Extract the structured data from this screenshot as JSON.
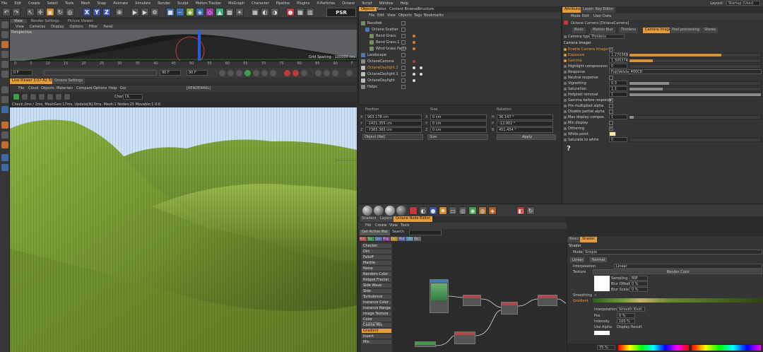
{
  "menubar": [
    "File",
    "Edit",
    "Create",
    "Select",
    "Tools",
    "Mesh",
    "Snap",
    "Animate",
    "Simulate",
    "Render",
    "Sculpt",
    "Motion Tracker",
    "MoGraph",
    "Character",
    "Pipeline",
    "Plugins",
    "X-Particles",
    "Octane",
    "Script",
    "Window",
    "Help"
  ],
  "layout": {
    "label": "Layout:",
    "value": "Startup (User)"
  },
  "toolbar": {
    "x": "X",
    "y": "Y",
    "z": "Z",
    "psr": "PSR"
  },
  "viewport": {
    "tabs": [
      "View",
      "Render Settings",
      "Picture Viewer"
    ],
    "menus": [
      "View",
      "Cameras",
      "Display",
      "Options",
      "Filter",
      "Panel"
    ],
    "label": "Perspective",
    "grid": "Grid Spacing : 100000 cm"
  },
  "timeline": {
    "ticks": [
      "0",
      "5",
      "10",
      "15",
      "20",
      "25",
      "30",
      "35",
      "40",
      "45",
      "50",
      "55",
      "60",
      "65",
      "70",
      "75",
      "80",
      "85",
      "90",
      "F"
    ],
    "start": "0 F",
    "end": "90 F",
    "current": "90 F"
  },
  "liveviewer": {
    "tabs": [
      "Live Viewer 3.07-R2 Studio",
      "Octane Settings"
    ],
    "menus": [
      "File",
      "Cloud",
      "Objects",
      "Materials",
      "Compare",
      "Options",
      "Help",
      "Gui"
    ],
    "channel_label": "Chan:",
    "channel_value": "DL",
    "rendering": "[RENDERING]",
    "status": "Check:2ms / 2ms, MeshGen:17ms, Update[N]:0ms, Mesh:1 Nodes:25 Movable:1 0:0"
  },
  "objmgr": {
    "tabs": [
      "Objects",
      "Takes",
      "Content Browser",
      "Structure"
    ],
    "menus": [
      "File",
      "Edit",
      "View",
      "Objects",
      "Tags",
      "Bookmarks"
    ],
    "rows": [
      "Bendtek",
      "Octane Scatter",
      "Bend Grass",
      "Bend Grass.1",
      "Wind Grass Patch",
      "Landscape",
      "OctaneCamera",
      "OctaneDaylight.2",
      "OctaneDaylight.1",
      "OctaneDaylight",
      "Helps"
    ]
  },
  "coords": {
    "headers": [
      "Position",
      "Size",
      "Rotation"
    ],
    "rows": [
      {
        "axis": "X",
        "pos": "963.178 cm",
        "size": "0 cm",
        "rotL": "H",
        "rot": "36.147 °"
      },
      {
        "axis": "Y",
        "pos": "-1421.355 cm",
        "size": "0 cm",
        "rotL": "P",
        "rot": "-12.902 °"
      },
      {
        "axis": "Z",
        "pos": "-7365.365 cm",
        "size": "0 cm",
        "rotL": "B",
        "rot": "451.454 °"
      }
    ],
    "mode": "Object (Rel)",
    "sizemode": "Size",
    "apply": "Apply"
  },
  "attr": {
    "tabs": [
      "Attributes",
      "Layers",
      "Key Editor"
    ],
    "menus": [
      "Mode",
      "Edit",
      "User Data"
    ],
    "object": "Octane Camera [OctaneCamera]",
    "subtabs": [
      "Basic",
      "Motion Blur",
      "Thinlens",
      "Camera Imager",
      "Post processing",
      "Stereo"
    ],
    "camtype_label": "Camera type",
    "camtype": "Thinlens",
    "section": "Camera Imager",
    "params": [
      {
        "label": "Enable Camera Imager",
        "type": "check",
        "value": "✓",
        "orange": true
      },
      {
        "label": "Exposure",
        "type": "slider",
        "value": "1.270369",
        "fill": 0.7,
        "orange": true
      },
      {
        "label": "Gamma",
        "type": "slider",
        "value": "1.305374",
        "fill": 0.18,
        "orange": true
      },
      {
        "label": "Highlight compression",
        "type": "slider",
        "value": "0",
        "fill": 0.0
      },
      {
        "label": "Response",
        "type": "dropdown",
        "value": "Fuji|Velvia_400CD"
      },
      {
        "label": "Neutral response",
        "type": "check",
        "value": ""
      },
      {
        "label": "Vignetting",
        "type": "slider",
        "value": "0.3",
        "fill": 0.3
      },
      {
        "label": "Saturation",
        "type": "slider",
        "value": "1.1",
        "fill": 0.25
      },
      {
        "label": "Hotpixel removal",
        "type": "slider",
        "value": "1",
        "fill": 1.0
      },
      {
        "label": "Gamma before response",
        "type": "check",
        "value": "✓"
      },
      {
        "label": "Pre-multiplied alpha",
        "type": "check",
        "value": ""
      },
      {
        "label": "Disable partial alpha",
        "type": "check",
        "value": ""
      },
      {
        "label": "Max display compos.",
        "type": "slider",
        "value": "1",
        "fill": 0.03
      },
      {
        "label": "Min display",
        "type": "check",
        "value": ""
      },
      {
        "label": "Dithering",
        "type": "check",
        "value": "✓"
      },
      {
        "label": "White point",
        "type": "color",
        "value": ""
      },
      {
        "label": "Saturate to white",
        "type": "slider",
        "value": "0",
        "fill": 0.0
      }
    ],
    "help": "?"
  },
  "nodeeditor": {
    "tabs": [
      "Shaders",
      "Layers",
      "Octane Node Editor"
    ],
    "menus": [
      "File",
      "Create",
      "View",
      "Tools"
    ],
    "get_active": "Get Active Mat",
    "search": "Search",
    "color_tabs": [
      "Mat",
      "Tex",
      "Gen",
      "Map",
      "Em",
      "Med",
      "C4D",
      "Ov"
    ],
    "nodes": [
      "Checker",
      "Dirt",
      "Falloff",
      "Marble",
      "Noise",
      "Random Color",
      "Ridged Fractal",
      "Side Wave",
      "Side",
      "Turbulence",
      "Instance Color",
      "Instance Range",
      "Image Texture",
      "Color Correction",
      "Cosine Mix",
      "Gradient",
      "Invert",
      "Mix"
    ],
    "selected_index": 15
  },
  "shader": {
    "tabs": [
      "Basic",
      "Shader"
    ],
    "title": "Shader",
    "mode_label": "Mode",
    "mode": "Simple",
    "buttons": [
      "Linear",
      "Normal"
    ],
    "interp_label": "Interpolation",
    "interp": "Linear",
    "texture_label": "Texture",
    "sampling_label": "Sampling",
    "sampling": "MIP",
    "blur_offset_label": "Blur Offset",
    "blur_offset": "0 %",
    "blur_scale_label": "Blur Scale",
    "blur_scale": "0 %",
    "render_label": "Render Color",
    "smoothing_label": "Smoothing",
    "smoothing": "✓",
    "gradient_label": "Gradient",
    "interp2_label": "Interpolation",
    "interp2": "Smooth Knot",
    "pos_label": "Pos",
    "pos": "0 %",
    "intensity_label": "Intensity",
    "intensity": "100 %",
    "use_alpha": "Use Alpha",
    "display": "Display Result",
    "zoom": "75 %"
  },
  "colors": {
    "accent": "#e59c3a",
    "axis_x": "#3a57a8"
  }
}
